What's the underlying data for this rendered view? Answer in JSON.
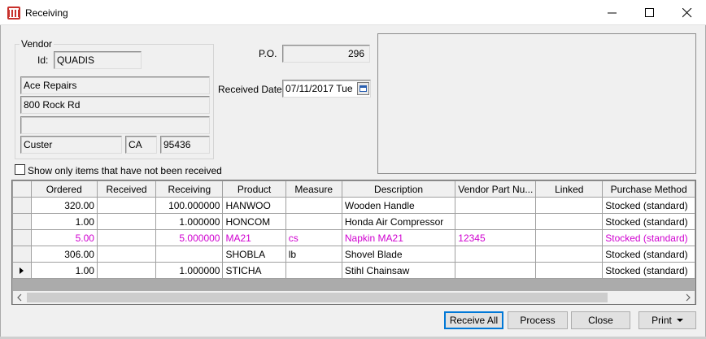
{
  "window": {
    "title": "Receiving"
  },
  "vendor": {
    "group_label": "Vendor",
    "id_label": "Id:",
    "id": "QUADIS",
    "name": "Ace Repairs",
    "address1": "800 Rock Rd",
    "address2": "",
    "city": "Custer",
    "state": "CA",
    "zip": "95436"
  },
  "po": {
    "label": "P.O.",
    "value": "296"
  },
  "received_date": {
    "label": "Received Date:",
    "value": "07/11/2017 Tue"
  },
  "filter": {
    "label": "Show only items that have not been received",
    "checked": false
  },
  "grid": {
    "columns": [
      "Ordered",
      "Received",
      "Receiving",
      "Product",
      "Measure",
      "Description",
      "Vendor Part Nu...",
      "Linked",
      "Purchase Method"
    ],
    "rows": [
      {
        "ordered": "320.00",
        "received": "",
        "receiving": "100.000000",
        "product": "HANWOO",
        "measure": "",
        "description": "Wooden Handle",
        "vendor_part": "",
        "linked": "",
        "purchase_method": "Stocked (standard)"
      },
      {
        "ordered": "1.00",
        "received": "",
        "receiving": "1.000000",
        "product": "HONCOM",
        "measure": "",
        "description": "Honda Air Compressor",
        "vendor_part": "",
        "linked": "",
        "purchase_method": "Stocked (standard)"
      },
      {
        "ordered": "5.00",
        "received": "",
        "receiving": "5.000000",
        "product": "MA21",
        "measure": "cs",
        "description": "Napkin  MA21",
        "vendor_part": "12345",
        "linked": "",
        "purchase_method": "Stocked (standard)"
      },
      {
        "ordered": "306.00",
        "received": "",
        "receiving": "",
        "product": "SHOBLA",
        "measure": "lb",
        "description": "Shovel Blade",
        "vendor_part": "",
        "linked": "",
        "purchase_method": "Stocked (standard)"
      },
      {
        "ordered": "1.00",
        "received": "",
        "receiving": "1.000000",
        "product": "STICHA",
        "measure": "",
        "description": "Stihl Chainsaw",
        "vendor_part": "",
        "linked": "",
        "purchase_method": "Stocked (standard)"
      }
    ]
  },
  "buttons": {
    "receive_all": "Receive All",
    "process": "Process",
    "close": "Close",
    "print": "Print"
  },
  "colors": {
    "highlight_row": "#d000d0",
    "default_button_border": "#0078d7"
  }
}
